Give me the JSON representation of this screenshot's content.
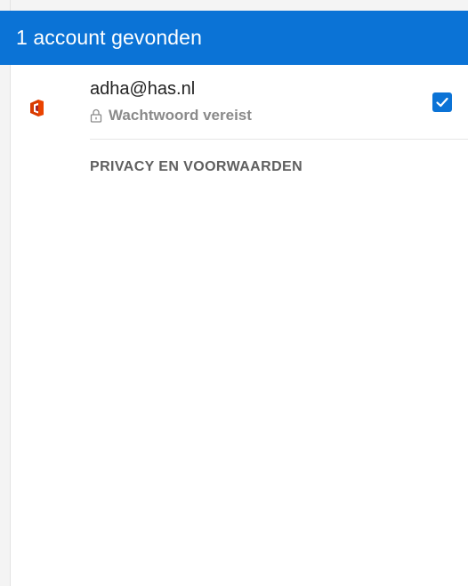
{
  "header": {
    "title": "1 account gevonden",
    "background_color": "#0b73d6"
  },
  "account": {
    "email": "adha@has.nl",
    "status": "Wachtwoord vereist",
    "selected": true,
    "provider_icon": "microsoft-office-icon",
    "status_icon": "lock-icon"
  },
  "footer": {
    "privacy_link": "PRIVACY EN VOORWAARDEN"
  }
}
